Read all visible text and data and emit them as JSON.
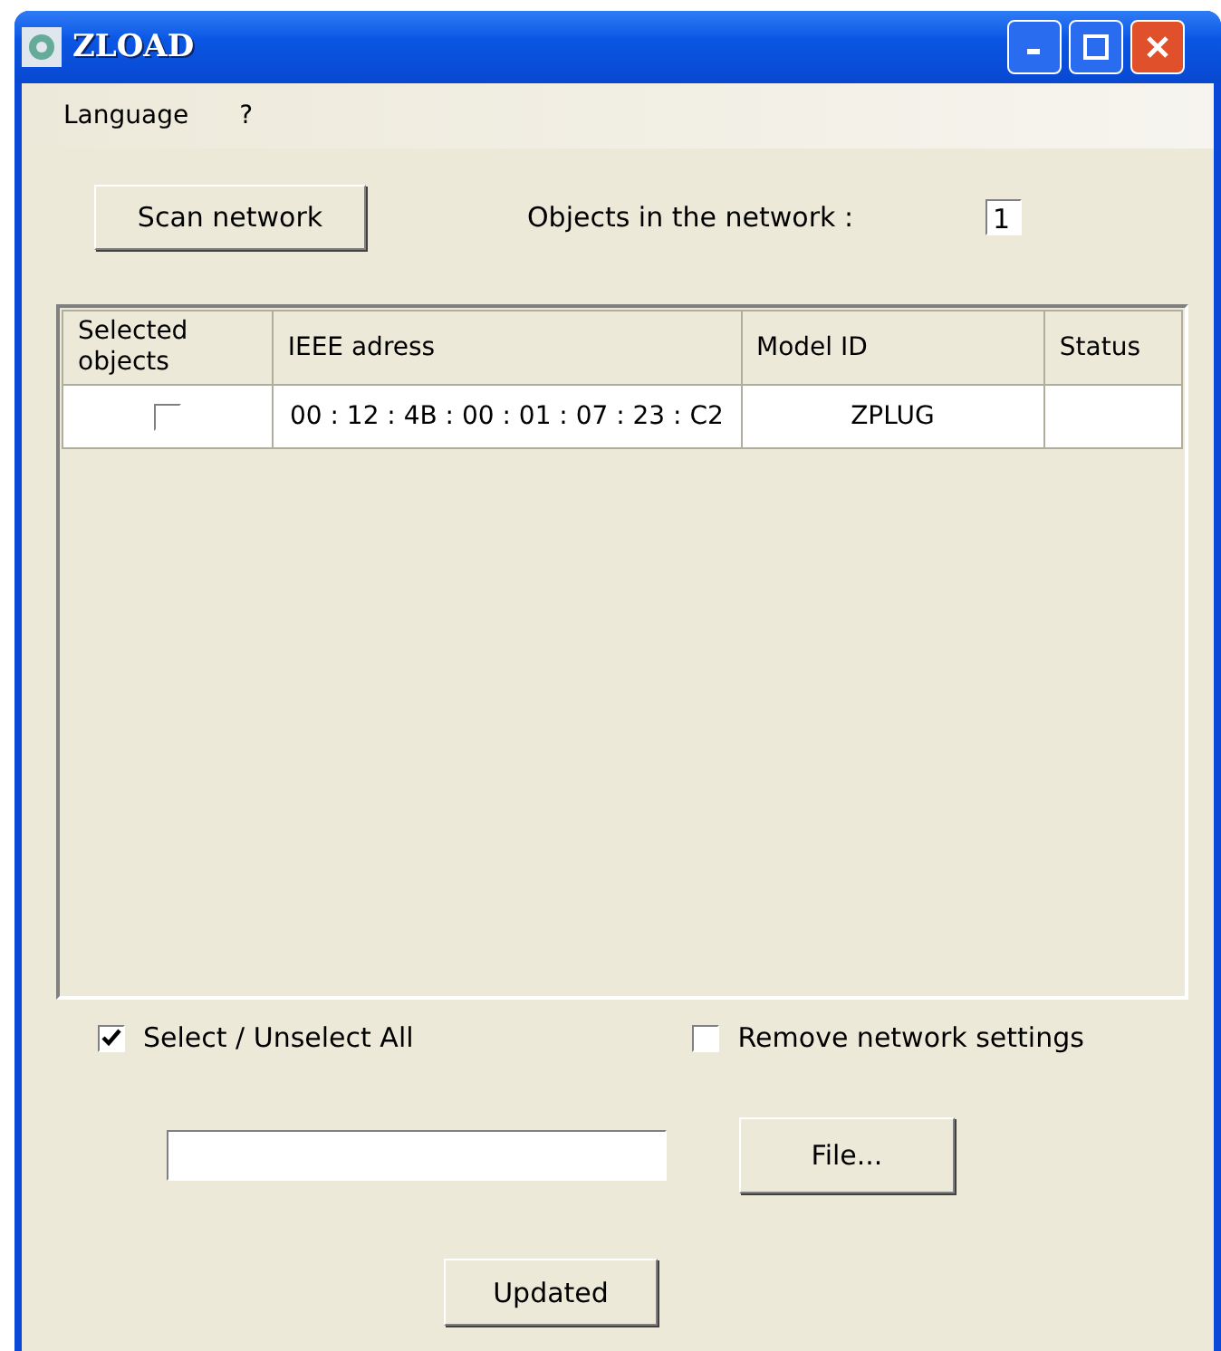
{
  "window": {
    "title": "ZLOAD"
  },
  "menu": [
    "Language",
    "?"
  ],
  "scan_button": "Scan network",
  "objects_label": "Objects in the network :",
  "objects_count": "1",
  "table": {
    "columns": [
      "Selected\nobjects",
      "IEEE adress",
      "Model ID",
      "Status"
    ],
    "rows": [
      {
        "checked": false,
        "address": "00 : 12 : 4B : 00 : 01 : 07 : 23 : C2",
        "model": "ZPLUG",
        "status": ""
      }
    ]
  },
  "select_all": {
    "label": "Select / Unselect All",
    "checked": true
  },
  "remove_settings": {
    "label": "Remove network settings",
    "checked": false
  },
  "file_button": "File...",
  "update_button": "Updated"
}
